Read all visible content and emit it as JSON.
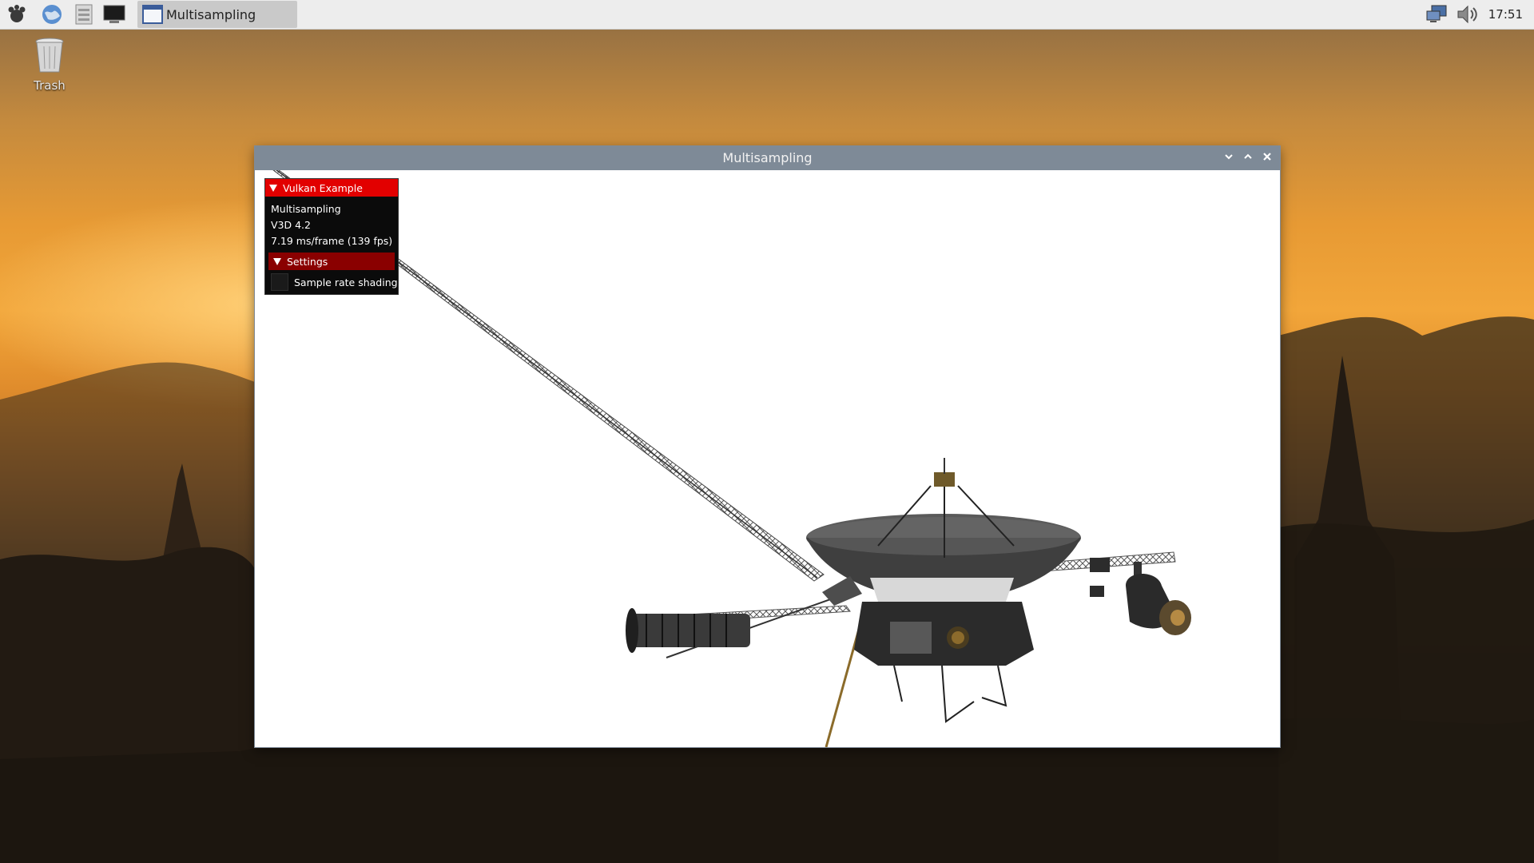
{
  "taskbar": {
    "launchers": [
      {
        "icon": "raspberry-menu-icon"
      },
      {
        "icon": "web-browser-icon"
      },
      {
        "icon": "file-manager-icon"
      },
      {
        "icon": "terminal-icon"
      }
    ],
    "task": {
      "label": "Multisampling",
      "icon": "app-window-icon"
    },
    "tray": {
      "network_icon": "network-icon",
      "volume_icon": "volume-icon"
    },
    "clock": "17:51"
  },
  "desktop": {
    "trash_label": "Trash"
  },
  "window": {
    "title": "Multisampling",
    "controls": {
      "minimize": "chevron-down-icon",
      "maximize": "chevron-up-icon",
      "close": "close-icon"
    }
  },
  "overlay": {
    "header": "Vulkan Example",
    "lines": [
      "Multisampling",
      "V3D 4.2",
      "7.19 ms/frame (139 fps)"
    ],
    "settings_header": "Settings",
    "checkbox_label": "Sample rate shading",
    "checkbox_checked": false
  },
  "colors": {
    "overlay_header": "#e20000",
    "settings_header": "#8a0000",
    "titlebar": "#7e8a97"
  }
}
